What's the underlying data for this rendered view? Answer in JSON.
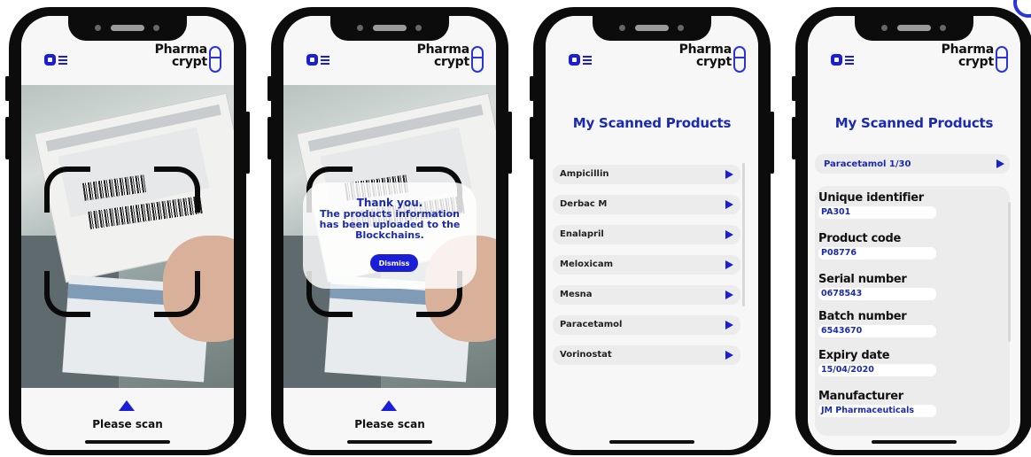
{
  "brand": {
    "line1": "Pharma",
    "line2": "crypt"
  },
  "scan": {
    "label": "Please scan"
  },
  "modal": {
    "line1": "Thank you.",
    "line2": "The products information",
    "line3": "has been uploaded to the",
    "line4": "Blockchains.",
    "dismiss": "Dismiss"
  },
  "list_screen": {
    "title": "My Scanned Products",
    "items": [
      "Ampicillin",
      "Derbac M",
      "Enalapril",
      "Meloxicam",
      "Mesna",
      "Paracetamol",
      "Vorinostat"
    ]
  },
  "detail_screen": {
    "title": "My Scanned Products",
    "selected": "Paracetamol 1/30",
    "fields": [
      {
        "label": "Unique identifier",
        "value": "PA301"
      },
      {
        "label": "Product code",
        "value": "P08776"
      },
      {
        "label": "Serial number",
        "value": "0678543"
      },
      {
        "label": "Batch number",
        "value": "6543670"
      },
      {
        "label": "Expiry date",
        "value": "15/04/2020"
      },
      {
        "label": "Manufacturer",
        "value": "JM Pharmaceuticals"
      }
    ]
  },
  "colors": {
    "accent": "#1a1fd6",
    "title": "#1b2bb0",
    "frame": "#0a0a0a"
  },
  "icons": {
    "menu": "menu-icon",
    "arrow": "arrow-right-icon",
    "scan": "arrow-up-icon",
    "logo": "pharmacrypt-logo-icon"
  }
}
